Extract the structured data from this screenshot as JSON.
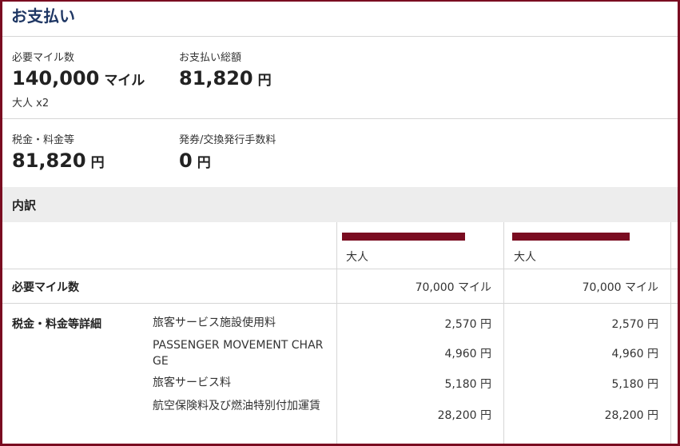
{
  "page": {
    "title": "お支払い"
  },
  "summary": {
    "miles_label": "必要マイル数",
    "miles_value": "140,000",
    "miles_unit": "マイル",
    "miles_sub": "大人 x2",
    "total_label": "お支払い総額",
    "total_value": "81,820",
    "total_unit": "円",
    "tax_label": "税金・料金等",
    "tax_value": "81,820",
    "tax_unit": "円",
    "fee_label": "発券/交換発行手数料",
    "fee_value": "0",
    "fee_unit": "円"
  },
  "breakdown": {
    "heading": "内訳",
    "passengers": [
      {
        "type": "大人"
      },
      {
        "type": "大人"
      }
    ],
    "miles_row": {
      "label": "必要マイル数",
      "values": [
        "70,000 マイル",
        "70,000 マイル"
      ]
    },
    "tax_detail": {
      "label": "税金・料金等詳細",
      "items": [
        {
          "name": "旅客サービス施設使用料",
          "values": [
            "2,570 円",
            "2,570 円"
          ]
        },
        {
          "name": "PASSENGER MOVEMENT CHARGE",
          "values": [
            "4,960 円",
            "4,960 円"
          ]
        },
        {
          "name": "旅客サービス料",
          "values": [
            "5,180 円",
            "5,180 円"
          ]
        },
        {
          "name": "航空保険料及び燃油特別付加運賃",
          "values": [
            "28,200 円",
            "28,200 円"
          ]
        }
      ]
    }
  },
  "colors": {
    "border": "#7a0c21",
    "title": "#1f3764",
    "section_bg": "#ededed"
  }
}
